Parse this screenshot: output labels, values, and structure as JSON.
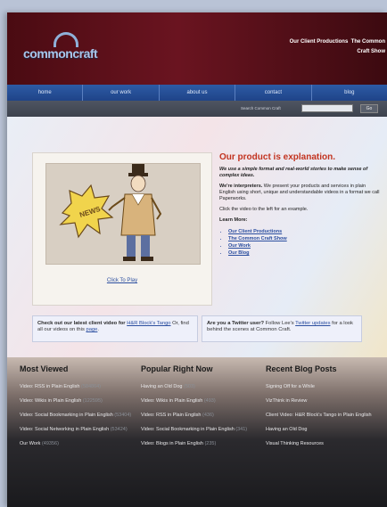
{
  "header": {
    "logo_text": "commoncraft",
    "links": [
      "Our Client Productions",
      "The Common Craft Show"
    ]
  },
  "nav": {
    "items": [
      "home",
      "our work",
      "about us",
      "contact",
      "blog"
    ]
  },
  "search": {
    "label": "Search Common Craft",
    "go_label": "Go",
    "value": ""
  },
  "main": {
    "video": {
      "sign_text": "NEWS",
      "play_label": "Click To Play"
    },
    "headline": "Our product is explanation.",
    "tagline": "We use a simple format and real-world stories to make sense of complex ideas.",
    "interpreters_lead": "We're interpreters.",
    "interpreters_text": " We present your products and services in plain English using short, unique and understandable videos in a format we call Paperworks.",
    "click_text": "Click the video to the left for an example.",
    "learn_more_title": "Learn More:",
    "learn_more": [
      "Our Client Productions",
      "The Common Craft Show",
      "Our Work",
      "Our Blog"
    ]
  },
  "promos": {
    "client": {
      "lead": "Check out our latest client video for",
      "link": "H&R Block's Tango",
      "rest": " Or, find all our videos on this",
      "link2": "page",
      "end": "."
    },
    "twitter": {
      "lead": "Are you a Twitter user?",
      "mid": " Follow Lee's ",
      "link": "Twitter updates",
      "rest": " for a look behind the scenes at Common Craft."
    }
  },
  "footer": {
    "most_viewed": {
      "title": "Most Viewed",
      "items": [
        {
          "text": "Video: RSS in Plain English",
          "count": "(584864)"
        },
        {
          "text": "Video: Wikis in Plain English",
          "count": "(122595)"
        },
        {
          "text": "Video: Social Bookmarking in Plain English",
          "count": "(53404)"
        },
        {
          "text": "Video: Social Networking in Plain English",
          "count": "(53424)"
        },
        {
          "text": "Our Work",
          "count": "(49356)"
        }
      ]
    },
    "popular": {
      "title": "Popular Right Now",
      "items": [
        {
          "text": "Having an Old Dog",
          "count": "(503)"
        },
        {
          "text": "Video: Wikis in Plain English",
          "count": "(493)"
        },
        {
          "text": "Video: RSS in Plain English",
          "count": "(436)"
        },
        {
          "text": "Video: Social Bookmarking in Plain English",
          "count": "(341)"
        },
        {
          "text": "Video: Blogs in Plain English",
          "count": "(235)"
        }
      ]
    },
    "blog": {
      "title": "Recent Blog Posts",
      "items": [
        "Signing Off for a While",
        "VizThink in Review",
        "Client Video: H&R Block's Tango in Plain English",
        "Having an Old Dog",
        "Visual Thinking Resources"
      ]
    }
  }
}
